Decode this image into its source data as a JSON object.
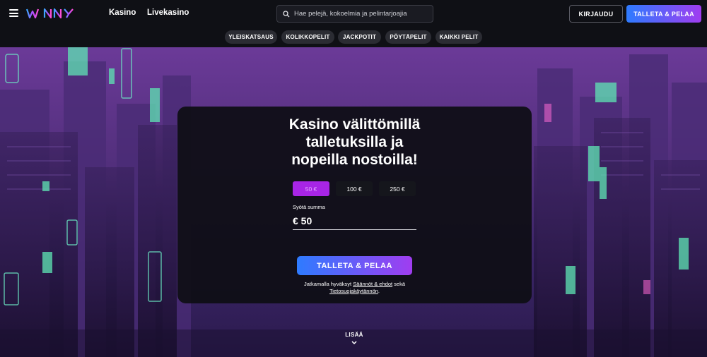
{
  "header": {
    "brand": "WINNY",
    "nav": {
      "kasino": "Kasino",
      "livekasino": "Livekasino"
    },
    "search": {
      "placeholder": "Hae pelejä, kokoelmia ja pelintarjoajia"
    },
    "login_label": "KIRJAUDU",
    "deposit_label": "TALLETA & PELAA"
  },
  "categories": [
    "YLEISKATSAUS",
    "KOLIKKOPELIT",
    "JACKPOTIT",
    "PÖYTÄPELIT",
    "KAIKKI PELIT"
  ],
  "hero": {
    "headline_lines": [
      "Kasino välittömillä",
      "talletuksilla ja",
      "nopeilla nostoilla!"
    ],
    "amounts": [
      "50 €",
      "100 €",
      "250 €"
    ],
    "selected_amount": "50 €",
    "input_label": "Syötä summa",
    "input_value": "€ 50",
    "deposit_button": "TALLETA & PELAA",
    "terms": {
      "prefix": "Jatkamalla hyväksyt ",
      "link1": "Säännöt & ehdot",
      "middle": " sekä",
      "link2": "Tietosuojakäytännön",
      "suffix": "."
    }
  },
  "more_label": "LISÄÄ",
  "colors": {
    "accent_blue": "#2e7bff",
    "accent_purple": "#a03df0",
    "selected_amount": "#a825e6",
    "header_bg": "#0f1015"
  },
  "icons": [
    "menu-icon",
    "search-icon",
    "chevron-down-icon"
  ]
}
